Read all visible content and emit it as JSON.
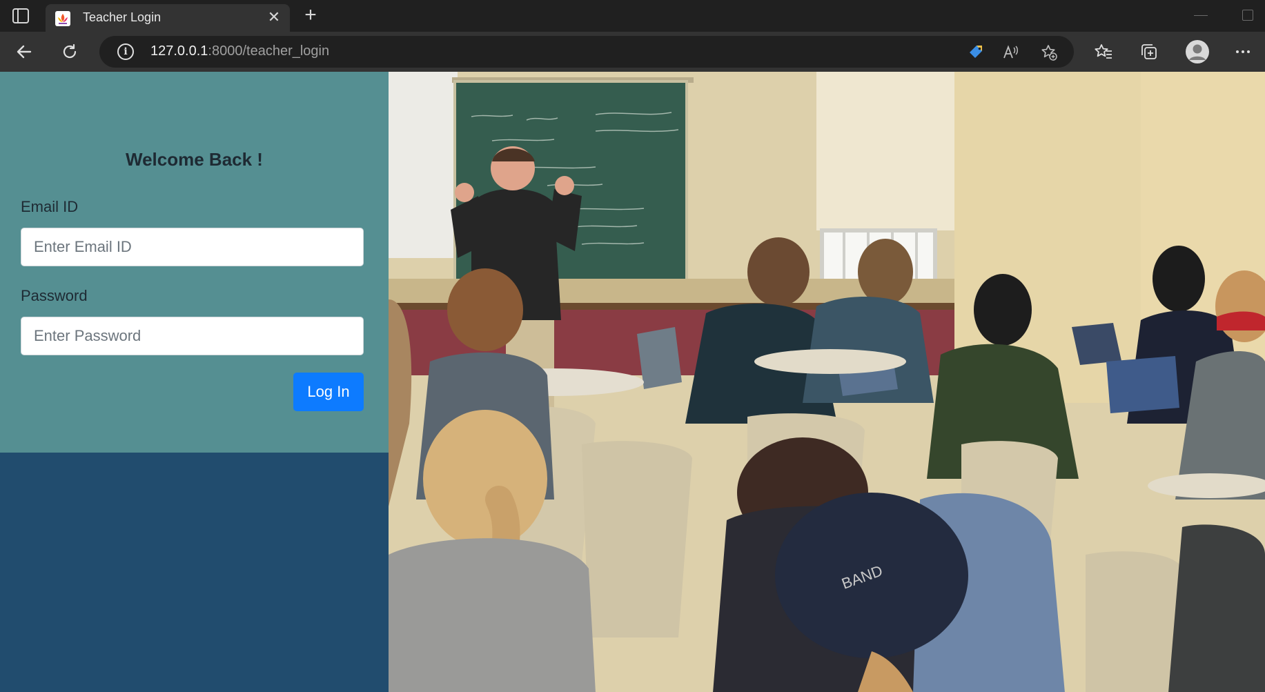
{
  "browser": {
    "tab_title": "Teacher Login",
    "url_host": "127.0.0.1",
    "url_rest": ":8000/teacher_login"
  },
  "login": {
    "heading": "Welcome Back !",
    "email_label": "Email ID",
    "email_placeholder": "Enter Email ID",
    "email_value": "",
    "password_label": "Password",
    "password_placeholder": "Enter Password",
    "password_value": "",
    "submit_label": "Log In"
  },
  "colors": {
    "login_panel": "#558f92",
    "lower_panel": "#214c6e",
    "button": "#0d7bff"
  },
  "icons": [
    "sidebar-toggle-icon",
    "favicon-icon",
    "close-icon",
    "new-tab-icon",
    "back-icon",
    "refresh-icon",
    "info-icon",
    "coupon-tag-icon",
    "read-aloud-icon",
    "add-favorite-icon",
    "favorites-icon",
    "collections-icon",
    "profile-avatar-icon",
    "more-menu-icon"
  ]
}
